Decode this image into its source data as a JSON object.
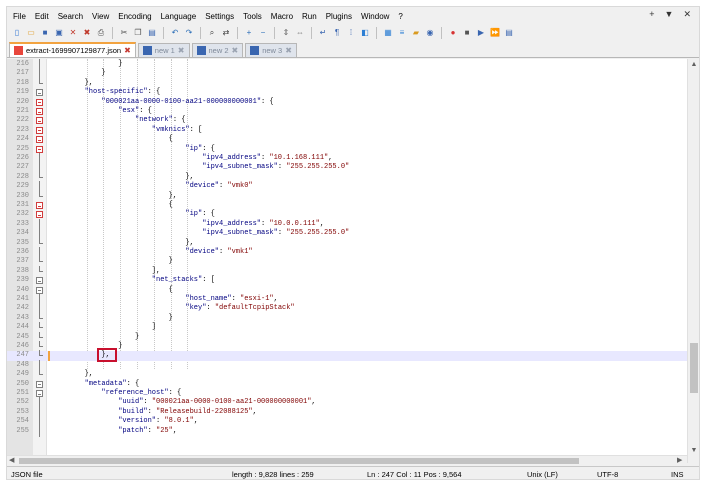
{
  "menu": [
    "File",
    "Edit",
    "Search",
    "View",
    "Encoding",
    "Language",
    "Settings",
    "Tools",
    "Macro",
    "Run",
    "Plugins",
    "Window",
    "?"
  ],
  "window_controls": [
    "+",
    "▼",
    "✕"
  ],
  "toolbar_icons": [
    "new-file-icon",
    "open-file-icon",
    "save-icon",
    "save-all-icon",
    "close-icon",
    "close-all-icon",
    "print-icon",
    "cut-icon",
    "copy-icon",
    "paste-icon",
    "undo-icon",
    "redo-icon",
    "find-icon",
    "replace-icon",
    "zoom-in-icon",
    "zoom-out-icon",
    "sync-vertical-icon",
    "sync-horizontal-icon",
    "word-wrap-icon",
    "show-all-chars-icon",
    "indent-guide-icon",
    "user-defined-language-icon",
    "document-map-icon",
    "function-list-icon",
    "folder-workspace-icon",
    "monitoring-icon",
    "record-macro-icon",
    "stop-macro-icon",
    "play-macro-icon",
    "run-macro-multiple-icon",
    "save-macro-icon"
  ],
  "tabs": [
    {
      "label": "extract-1699907129877.json",
      "active": true
    },
    {
      "label": "new 1",
      "active": false
    },
    {
      "label": "new 2",
      "active": false
    },
    {
      "label": "new 3",
      "active": false
    }
  ],
  "lines": [
    {
      "n": "216",
      "fold": "vline",
      "indent": 16,
      "parts": [
        [
          "p",
          "}"
        ]
      ]
    },
    {
      "n": "217",
      "fold": "vline",
      "indent": 12,
      "parts": [
        [
          "p",
          "}"
        ]
      ]
    },
    {
      "n": "218",
      "fold": "end",
      "indent": 8,
      "parts": [
        [
          "p",
          "},"
        ]
      ]
    },
    {
      "n": "219",
      "fold": "box",
      "indent": 8,
      "parts": [
        [
          "k",
          "\"host-specific\""
        ],
        [
          "p",
          ": {"
        ]
      ]
    },
    {
      "n": "220",
      "fold": "box",
      "indent": 12,
      "parts": [
        [
          "k",
          "\"000021aa-0000-0100-aa21-000000000001\""
        ],
        [
          "p",
          ": {"
        ]
      ]
    },
    {
      "n": "221",
      "fold": "box",
      "indent": 16,
      "parts": [
        [
          "k",
          "\"esx\""
        ],
        [
          "p",
          ": {"
        ]
      ]
    },
    {
      "n": "222",
      "fold": "box",
      "indent": 20,
      "parts": [
        [
          "k",
          "\"network\""
        ],
        [
          "p",
          ": {"
        ]
      ]
    },
    {
      "n": "223",
      "fold": "box",
      "indent": 24,
      "parts": [
        [
          "k",
          "\"vmknics\""
        ],
        [
          "p",
          ": ["
        ]
      ]
    },
    {
      "n": "224",
      "fold": "box",
      "indent": 28,
      "parts": [
        [
          "p",
          "{"
        ]
      ]
    },
    {
      "n": "225",
      "fold": "box",
      "indent": 32,
      "parts": [
        [
          "k",
          "\"ip\""
        ],
        [
          "p",
          ": {"
        ]
      ]
    },
    {
      "n": "226",
      "fold": "vline",
      "indent": 36,
      "parts": [
        [
          "k",
          "\"ipv4_address\""
        ],
        [
          "p",
          ": "
        ],
        [
          "s",
          "\"10.1.168.111\""
        ],
        [
          "p",
          ","
        ]
      ]
    },
    {
      "n": "227",
      "fold": "vline",
      "indent": 36,
      "parts": [
        [
          "k",
          "\"ipv4_subnet_mask\""
        ],
        [
          "p",
          ": "
        ],
        [
          "s",
          "\"255.255.255.0\""
        ]
      ]
    },
    {
      "n": "228",
      "fold": "end",
      "indent": 32,
      "parts": [
        [
          "p",
          "},"
        ]
      ]
    },
    {
      "n": "229",
      "fold": "vline",
      "indent": 32,
      "parts": [
        [
          "k",
          "\"device\""
        ],
        [
          "p",
          ": "
        ],
        [
          "s",
          "\"vmk0\""
        ]
      ]
    },
    {
      "n": "230",
      "fold": "end",
      "indent": 28,
      "parts": [
        [
          "p",
          "},"
        ]
      ]
    },
    {
      "n": "231",
      "fold": "box",
      "indent": 28,
      "parts": [
        [
          "p",
          "{"
        ]
      ]
    },
    {
      "n": "232",
      "fold": "box",
      "indent": 32,
      "parts": [
        [
          "k",
          "\"ip\""
        ],
        [
          "p",
          ": {"
        ]
      ]
    },
    {
      "n": "233",
      "fold": "vline",
      "indent": 36,
      "parts": [
        [
          "k",
          "\"ipv4_address\""
        ],
        [
          "p",
          ": "
        ],
        [
          "s",
          "\"10.0.0.111\""
        ],
        [
          "p",
          ","
        ]
      ]
    },
    {
      "n": "234",
      "fold": "vline",
      "indent": 36,
      "parts": [
        [
          "k",
          "\"ipv4_subnet_mask\""
        ],
        [
          "p",
          ": "
        ],
        [
          "s",
          "\"255.255.255.0\""
        ]
      ]
    },
    {
      "n": "235",
      "fold": "end",
      "indent": 32,
      "parts": [
        [
          "p",
          "},"
        ]
      ]
    },
    {
      "n": "236",
      "fold": "vline",
      "indent": 32,
      "parts": [
        [
          "k",
          "\"device\""
        ],
        [
          "p",
          ": "
        ],
        [
          "s",
          "\"vmk1\""
        ]
      ]
    },
    {
      "n": "237",
      "fold": "end",
      "indent": 28,
      "parts": [
        [
          "p",
          "}"
        ]
      ]
    },
    {
      "n": "238",
      "fold": "end",
      "indent": 24,
      "parts": [
        [
          "p",
          "],"
        ]
      ]
    },
    {
      "n": "239",
      "fold": "box",
      "indent": 24,
      "parts": [
        [
          "k",
          "\"net_stacks\""
        ],
        [
          "p",
          ": ["
        ]
      ]
    },
    {
      "n": "240",
      "fold": "box",
      "indent": 28,
      "parts": [
        [
          "p",
          "{"
        ]
      ]
    },
    {
      "n": "241",
      "fold": "vline",
      "indent": 32,
      "parts": [
        [
          "k",
          "\"host_name\""
        ],
        [
          "p",
          ": "
        ],
        [
          "s",
          "\"esxi-1\""
        ],
        [
          "p",
          ","
        ]
      ]
    },
    {
      "n": "242",
      "fold": "vline",
      "indent": 32,
      "parts": [
        [
          "k",
          "\"key\""
        ],
        [
          "p",
          ": "
        ],
        [
          "s",
          "\"defaultTcpipStack\""
        ]
      ]
    },
    {
      "n": "243",
      "fold": "end",
      "indent": 28,
      "parts": [
        [
          "p",
          "}"
        ]
      ]
    },
    {
      "n": "244",
      "fold": "end",
      "indent": 24,
      "parts": [
        [
          "p",
          "]"
        ]
      ]
    },
    {
      "n": "245",
      "fold": "end",
      "indent": 20,
      "parts": [
        [
          "p",
          "}"
        ]
      ]
    },
    {
      "n": "246",
      "fold": "end",
      "indent": 16,
      "parts": [
        [
          "p",
          "}"
        ]
      ]
    },
    {
      "n": "247",
      "fold": "end",
      "indent": 12,
      "parts": [
        [
          "p",
          "},"
        ]
      ],
      "current": true,
      "highlight": true
    },
    {
      "n": "248",
      "fold": "vline",
      "indent": 0,
      "parts": []
    },
    {
      "n": "249",
      "fold": "end",
      "indent": 8,
      "parts": [
        [
          "p",
          "},"
        ]
      ]
    },
    {
      "n": "250",
      "fold": "box",
      "indent": 8,
      "parts": [
        [
          "k",
          "\"metadata\""
        ],
        [
          "p",
          ": {"
        ]
      ]
    },
    {
      "n": "251",
      "fold": "box",
      "indent": 12,
      "parts": [
        [
          "k",
          "\"reference_host\""
        ],
        [
          "p",
          ": {"
        ]
      ]
    },
    {
      "n": "252",
      "fold": "vline",
      "indent": 16,
      "parts": [
        [
          "k",
          "\"uuid\""
        ],
        [
          "p",
          ": "
        ],
        [
          "s",
          "\"000021aa-0000-0100-aa21-000000000001\""
        ],
        [
          "p",
          ","
        ]
      ]
    },
    {
      "n": "253",
      "fold": "vline",
      "indent": 16,
      "parts": [
        [
          "k",
          "\"build\""
        ],
        [
          "p",
          ": "
        ],
        [
          "s",
          "\"Releasebuild-22088125\""
        ],
        [
          "p",
          ","
        ]
      ]
    },
    {
      "n": "254",
      "fold": "vline",
      "indent": 16,
      "parts": [
        [
          "k",
          "\"version\""
        ],
        [
          "p",
          ": "
        ],
        [
          "s",
          "\"8.0.1\""
        ],
        [
          "p",
          ","
        ]
      ]
    },
    {
      "n": "255",
      "fold": "vline",
      "indent": 16,
      "parts": [
        [
          "k",
          "\"patch\""
        ],
        [
          "p",
          ": "
        ],
        [
          "s",
          "\"25\""
        ],
        [
          "p",
          ","
        ]
      ]
    }
  ],
  "colors": {
    "key": "#000080",
    "string": "#800000",
    "tab_accent": "#f2a340",
    "highlight_box": "#c8102e"
  },
  "status": {
    "file_type": "JSON file",
    "length_lines": "length : 9,828    lines : 259",
    "position": "Ln : 247    Col : 11    Pos : 9,564",
    "eol": "Unix (LF)",
    "encoding": "UTF-8",
    "mode": "INS"
  }
}
